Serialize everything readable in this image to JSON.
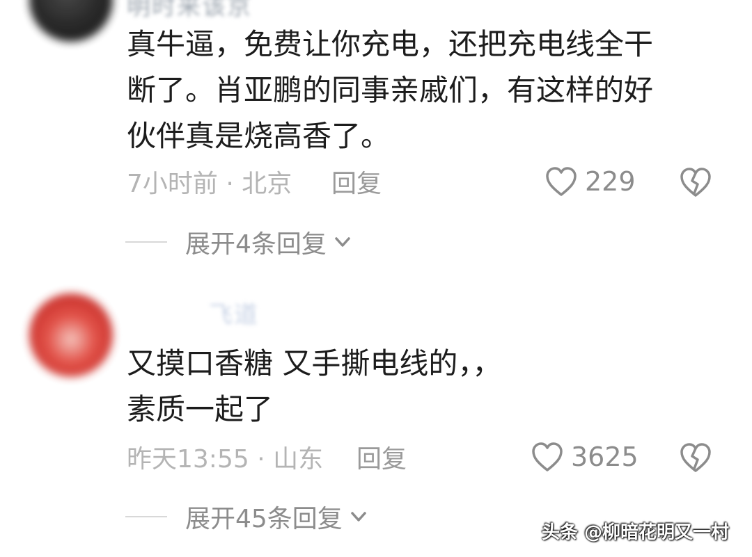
{
  "comments": [
    {
      "username": "明时来该京",
      "text_lines": [
        "真牛逼，免费让你充电，还把充电线全干",
        "断了。肖亚鹏的同事亲戚们，有这样的好",
        "伙伴真是烧高香了。"
      ],
      "meta": "7小时前 · 北京",
      "reply_label": "回复",
      "likes": "229",
      "expand_label": "展开4条回复"
    },
    {
      "username": "飞道",
      "text_lines": [
        "又摸口香糖 又手撕电线的，，",
        "素质一起了"
      ],
      "meta": "昨天13:55 · 山东",
      "reply_label": "回复",
      "likes": "3625",
      "expand_label": "展开45条回复"
    }
  ],
  "watermark": "头条 @柳暗花明又一村",
  "colors": {
    "text": "#1c1c1c",
    "meta": "#b4b4b4",
    "icon": "#8c8c8c"
  },
  "icons": [
    "heart-outline-icon",
    "broken-heart-icon",
    "chevron-down-icon"
  ]
}
